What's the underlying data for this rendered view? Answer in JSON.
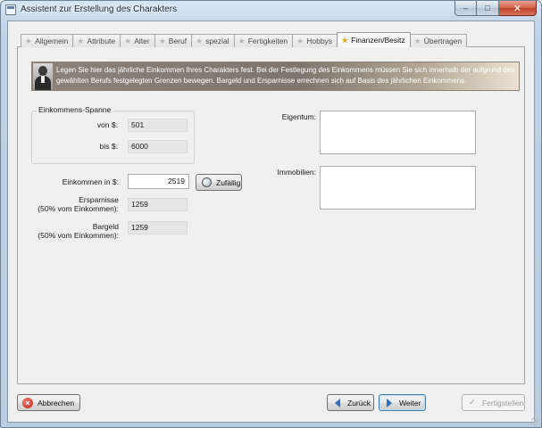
{
  "window": {
    "title": "Assistent zur Erstellung des Charakters"
  },
  "caption": {
    "minimize": "–",
    "maximize": "□",
    "close": "✕"
  },
  "tabs": [
    {
      "label": "Allgemein",
      "active": false
    },
    {
      "label": "Attribute",
      "active": false
    },
    {
      "label": "Alter",
      "active": false
    },
    {
      "label": "Beruf",
      "active": false
    },
    {
      "label": "spezial",
      "active": false
    },
    {
      "label": "Fertigkeiten",
      "active": false
    },
    {
      "label": "Hobbys",
      "active": false
    },
    {
      "label": "Finanzen/Besitz",
      "active": true
    },
    {
      "label": "Übertragen",
      "active": false
    }
  ],
  "banner": {
    "text": "Legen Sie hier das jährliche Einkommen Ihres Charakters fest. Bei der Festlegung des Einkommens müssen Sie sich innerhalb der aufgrund des gewählten Berufs festgelegten Grenzen bewegen. Bargeld und Ersparnisse errechnen sich auf Basis des jährlichen Einkommens."
  },
  "income_range": {
    "title": "Einkommens-Spanne",
    "from_label": "von $:",
    "from_value": "501",
    "to_label": "bis $:",
    "to_value": "6000"
  },
  "income": {
    "label": "Einkommen in $:",
    "value": "2519",
    "random_button": "Zufällig"
  },
  "savings": {
    "label_line1": "Ersparnisse",
    "label_line2": "(50% vom Einkommen):",
    "value": "1259"
  },
  "cash": {
    "label_line1": "Bargeld",
    "label_line2": "(50% vom Einkommen):",
    "value": "1259"
  },
  "property": {
    "label": "Eigentum:"
  },
  "real_estate": {
    "label": "Immobilien:"
  },
  "footer": {
    "cancel": "Abbrechen",
    "back": "Zurück",
    "next": "Weiter",
    "finish": "Fertigstellen"
  },
  "colors": {
    "active_tab_star": "#e6a21a",
    "banner_dark": "#7e766c",
    "banner_light": "#ede2d1"
  }
}
